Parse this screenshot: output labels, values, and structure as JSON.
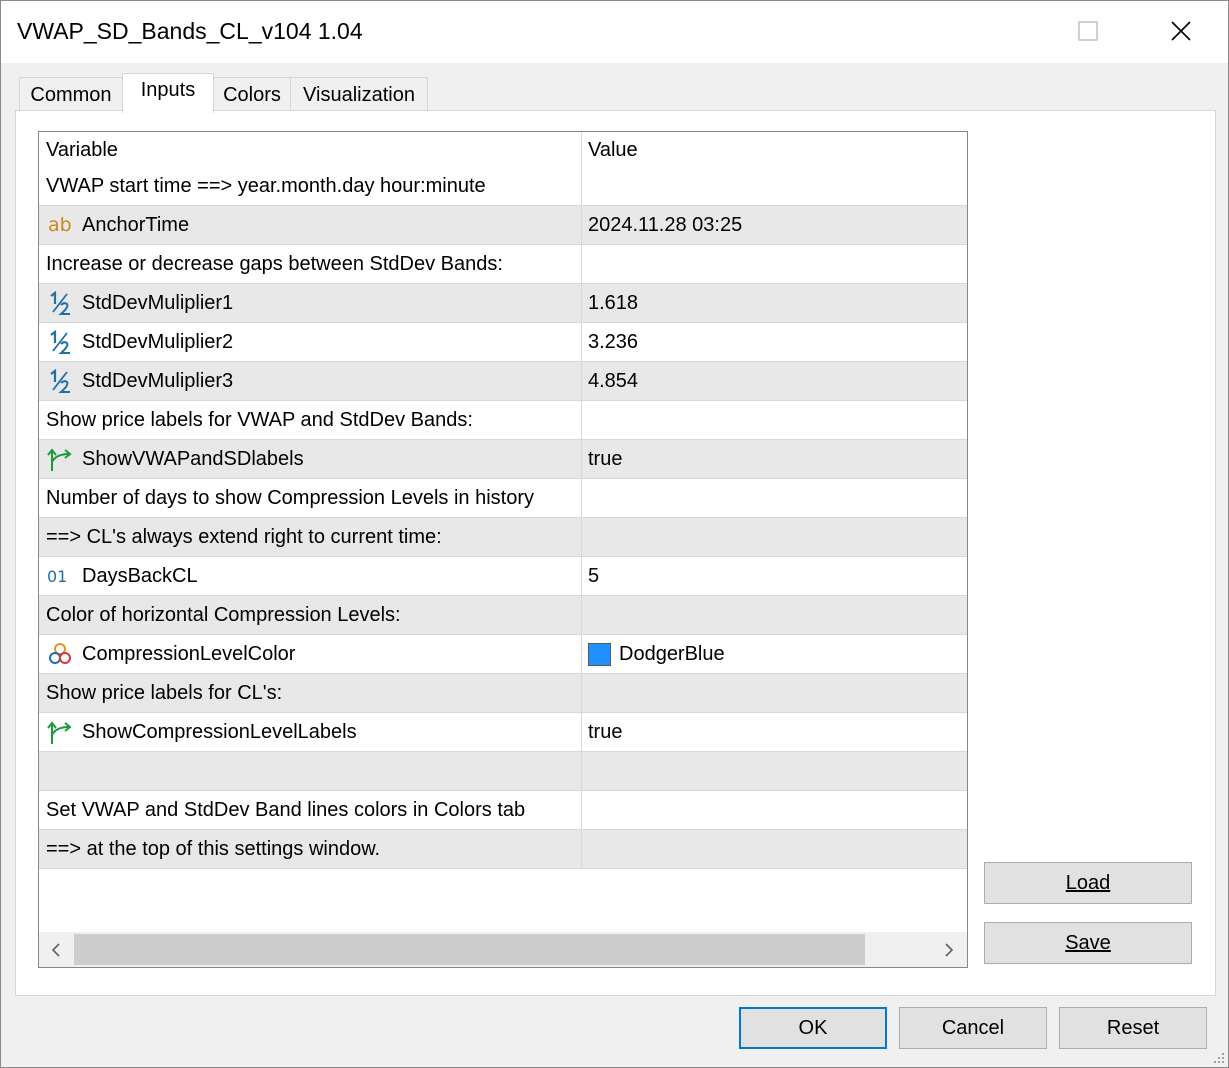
{
  "window": {
    "title": "VWAP_SD_Bands_CL_v104 1.04",
    "controls": {
      "maximize": "maximize-icon",
      "close": "close-icon"
    }
  },
  "tabs": [
    {
      "label": "Common",
      "active": false
    },
    {
      "label": "Inputs",
      "active": true
    },
    {
      "label": "Colors",
      "active": false
    },
    {
      "label": "Visualization",
      "active": false
    }
  ],
  "grid": {
    "header": {
      "variable": "Variable",
      "value": "Value"
    },
    "rows": [
      {
        "variable": "VWAP start time ==> year.month.day hour:minute",
        "value": "",
        "icon": ""
      },
      {
        "variable": "AnchorTime",
        "value": "2024.11.28 03:25",
        "icon": "string-icon"
      },
      {
        "variable": "Increase or decrease gaps between StdDev Bands:",
        "value": "",
        "icon": ""
      },
      {
        "variable": "StdDevMuliplier1",
        "value": "1.618",
        "icon": "double-icon"
      },
      {
        "variable": "StdDevMuliplier2",
        "value": "3.236",
        "icon": "double-icon"
      },
      {
        "variable": "StdDevMuliplier3",
        "value": "4.854",
        "icon": "double-icon"
      },
      {
        "variable": "Show price labels for VWAP and StdDev Bands:",
        "value": "",
        "icon": ""
      },
      {
        "variable": "ShowVWAPandSDlabels",
        "value": "true",
        "icon": "bool-icon"
      },
      {
        "variable": "Number of days to show Compression Levels in history",
        "value": "",
        "icon": ""
      },
      {
        "variable": "==> CL's always extend right to current time:",
        "value": "",
        "icon": ""
      },
      {
        "variable": "DaysBackCL",
        "value": "5",
        "icon": "integer-icon"
      },
      {
        "variable": "Color of horizontal Compression Levels:",
        "value": "",
        "icon": ""
      },
      {
        "variable": "CompressionLevelColor",
        "value": "DodgerBlue",
        "icon": "color-icon",
        "swatch": "#1e90ff"
      },
      {
        "variable": "Show price labels for CL's:",
        "value": "",
        "icon": ""
      },
      {
        "variable": "ShowCompressionLevelLabels",
        "value": "true",
        "icon": "bool-icon"
      },
      {
        "variable": "",
        "value": "",
        "icon": ""
      },
      {
        "variable": "Set VWAP and StdDev Band lines colors in Colors tab",
        "value": "",
        "icon": ""
      },
      {
        "variable": "==> at the top of this settings window.",
        "value": "",
        "icon": ""
      }
    ]
  },
  "side_buttons": {
    "load": "Load",
    "save": "Save"
  },
  "footer_buttons": {
    "ok": "OK",
    "cancel": "Cancel",
    "reset": "Reset"
  },
  "colors": {
    "accent": "#0078d7",
    "swatch": "#1e90ff"
  }
}
